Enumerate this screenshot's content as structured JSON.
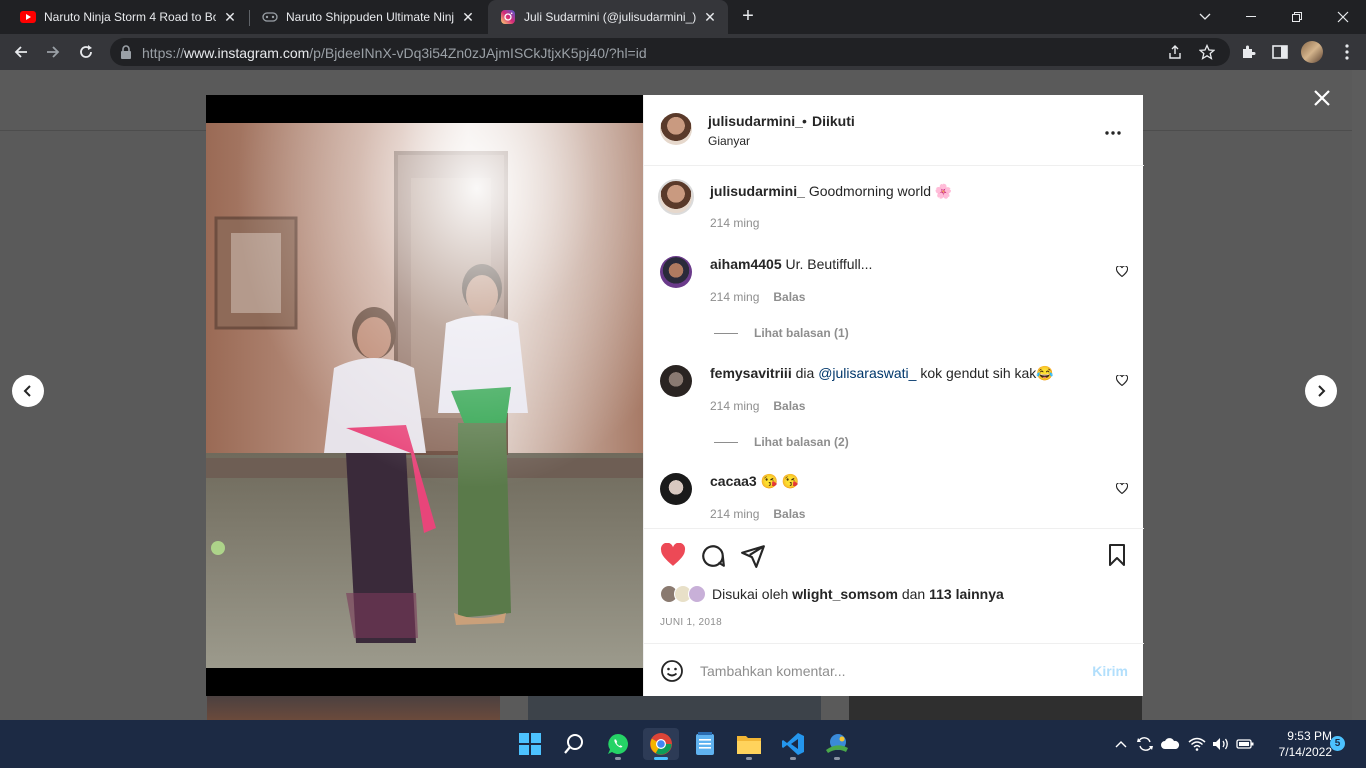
{
  "browser": {
    "tabs": [
      {
        "title": "Naruto Ninja Storm 4 Road to Bo",
        "icon": "youtube-icon"
      },
      {
        "title": "Naruto Shippuden Ultimate Ninja",
        "icon": "gamepad-icon"
      },
      {
        "title": "Juli Sudarmini (@julisudarmini_)",
        "icon": "instagram-icon"
      }
    ],
    "url_prefix": "https://",
    "url_domain": "www.instagram.com",
    "url_path": "/p/BjdeeINnX-vDq3i54Zn0zJAjmISCkJtjxK5pj40/?hl=id"
  },
  "post": {
    "author": "julisudarmini_",
    "follow_status": "Diikuti",
    "location": "Gianyar",
    "caption": "Goodmorning world 🌸",
    "caption_time": "214 ming",
    "comments": [
      {
        "user": "aiham4405",
        "text": "Ur. Beutiffull...",
        "time": "214 ming",
        "reply": "Balas",
        "view_replies": "Lihat balasan (1)"
      },
      {
        "user": "femysavitriii",
        "text_before": "dia ",
        "mention": "@julisaraswati_",
        "text_after": " kok gendut sih kak😂",
        "time": "214 ming",
        "reply": "Balas",
        "view_replies": "Lihat balasan (2)"
      },
      {
        "user": "cacaa3",
        "text": "😘 😘",
        "time": "214 ming",
        "reply": "Balas"
      }
    ],
    "likes_prefix": "Disukai oleh",
    "likes_user": "wlight_somsom",
    "likes_mid": "dan",
    "likes_count": "113 lainnya",
    "date": "JUNI 1, 2018",
    "comment_placeholder": "Tambahkan komentar...",
    "send_label": "Kirim"
  },
  "taskbar": {
    "time": "9:53 PM",
    "date": "7/14/2022",
    "notifications": "5"
  },
  "colors": {
    "like_red": "#ed4956",
    "link_blue": "#00376b",
    "send_disabled": "#b2dffc",
    "taskbar_bg": "#1c2a44"
  }
}
